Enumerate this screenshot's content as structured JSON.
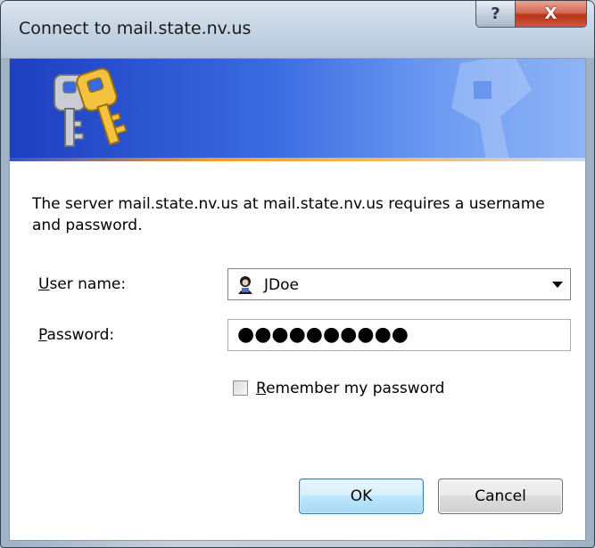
{
  "window": {
    "title": "Connect to mail.state.nv.us",
    "help_glyph": "?",
    "close_glyph": "X"
  },
  "banner": {
    "icon": "keys-icon",
    "colors": {
      "gradient_start": "#1d3fc0",
      "gradient_end": "#8fb4f6",
      "accent_line": "#f59a2a"
    }
  },
  "dialog": {
    "message": "The server mail.state.nv.us at mail.state.nv.us requires a username and password.",
    "username": {
      "label_accel": "U",
      "label_rest": "ser name:",
      "value": "JDoe",
      "icon": "user-icon"
    },
    "password": {
      "label_accel": "P",
      "label_rest": "assword:",
      "masked_value": "●●●●●●●●●●"
    },
    "remember": {
      "label_accel": "R",
      "label_rest": "emember my password",
      "checked": false
    },
    "buttons": {
      "ok": "OK",
      "cancel": "Cancel"
    }
  }
}
